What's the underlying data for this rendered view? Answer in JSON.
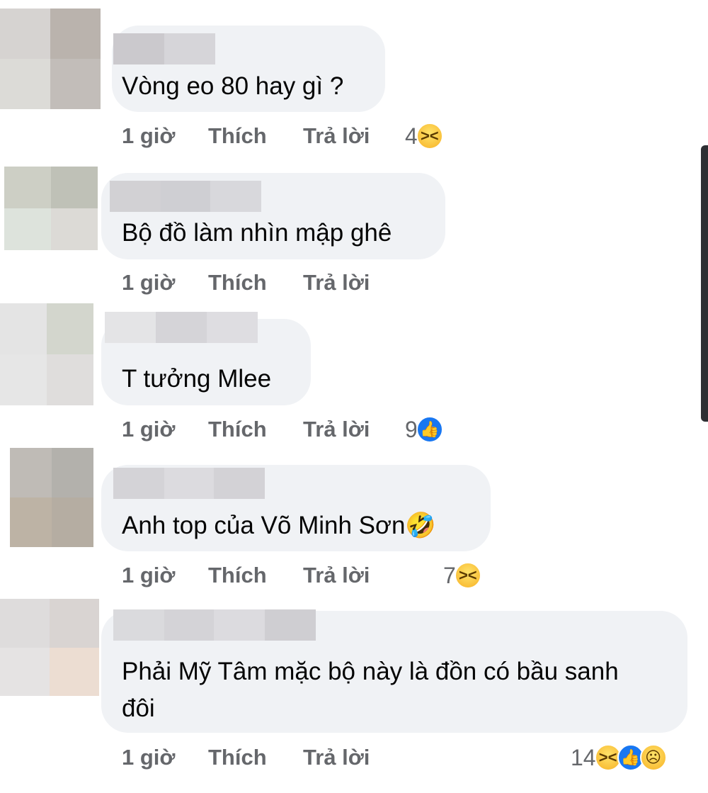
{
  "comments": [
    {
      "text": "Vòng eo 80 hay gì ?",
      "time": "1 giờ",
      "like_label": "Thích",
      "reply_label": "Trả lời",
      "reaction_count": "4",
      "reactions": [
        "haha-icon"
      ]
    },
    {
      "text": "Bộ đồ làm nhìn mập ghê",
      "time": "1 giờ",
      "like_label": "Thích",
      "reply_label": "Trả lời",
      "reaction_count": "",
      "reactions": []
    },
    {
      "text": "T tưởng Mlee",
      "time": "1 giờ",
      "like_label": "Thích",
      "reply_label": "Trả lời",
      "reaction_count": "9",
      "reactions": [
        "like-icon"
      ]
    },
    {
      "text": "Anh top của Võ Minh Sơn🤣",
      "time": "1 giờ",
      "like_label": "Thích",
      "reply_label": "Trả lời",
      "reaction_count": "7",
      "reactions": [
        "haha-icon"
      ]
    },
    {
      "text": "Phải Mỹ Tâm mặc bộ này là đồn có bầu sanh\nđôi",
      "time": "1 giờ",
      "like_label": "Thích",
      "reply_label": "Trả lời",
      "reaction_count": "14",
      "reactions": [
        "haha-icon",
        "like-icon",
        "sad-icon"
      ]
    }
  ],
  "colors": {
    "bubble": "#f0f2f5",
    "meta_text": "#65676b",
    "like_blue": "#1877f2",
    "haha_yellow": "#f7b125"
  }
}
